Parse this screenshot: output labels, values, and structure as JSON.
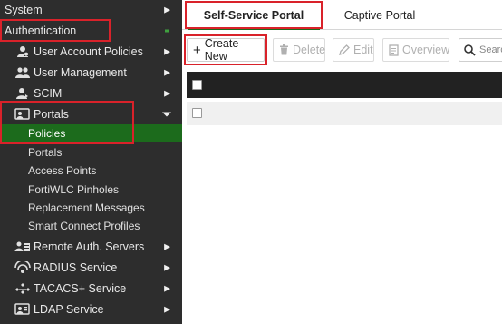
{
  "sidebar": {
    "system": "System",
    "authentication": "Authentication",
    "items": [
      {
        "label": "User Account Policies",
        "icon": "user-icon"
      },
      {
        "label": "User Management",
        "icon": "users-icon"
      },
      {
        "label": "SCIM",
        "icon": "user-icon"
      },
      {
        "label": "Portals",
        "icon": "portal-icon"
      }
    ],
    "portals_children": [
      "Policies",
      "Portals",
      "Access Points",
      "FortiWLC Pinholes",
      "Replacement Messages",
      "Smart Connect Profiles"
    ],
    "lower_items": [
      {
        "label": "Remote Auth. Servers",
        "icon": "server-icon"
      },
      {
        "label": "RADIUS Service",
        "icon": "radius-icon"
      },
      {
        "label": "TACACS+ Service",
        "icon": "tacacs-icon"
      },
      {
        "label": "LDAP Service",
        "icon": "ldap-icon"
      }
    ]
  },
  "tabs": [
    {
      "label": "Self-Service Portal",
      "active": true
    },
    {
      "label": "Captive Portal",
      "active": false
    }
  ],
  "toolbar": {
    "create_new": "Create New",
    "delete": "Delete",
    "edit": "Edit",
    "overview": "Overview",
    "search_placeholder": "Searc"
  },
  "colors": {
    "sidebar_bg": "#2d2d2d",
    "active_green": "#1c6b1c",
    "highlight_red": "#d9222a"
  }
}
